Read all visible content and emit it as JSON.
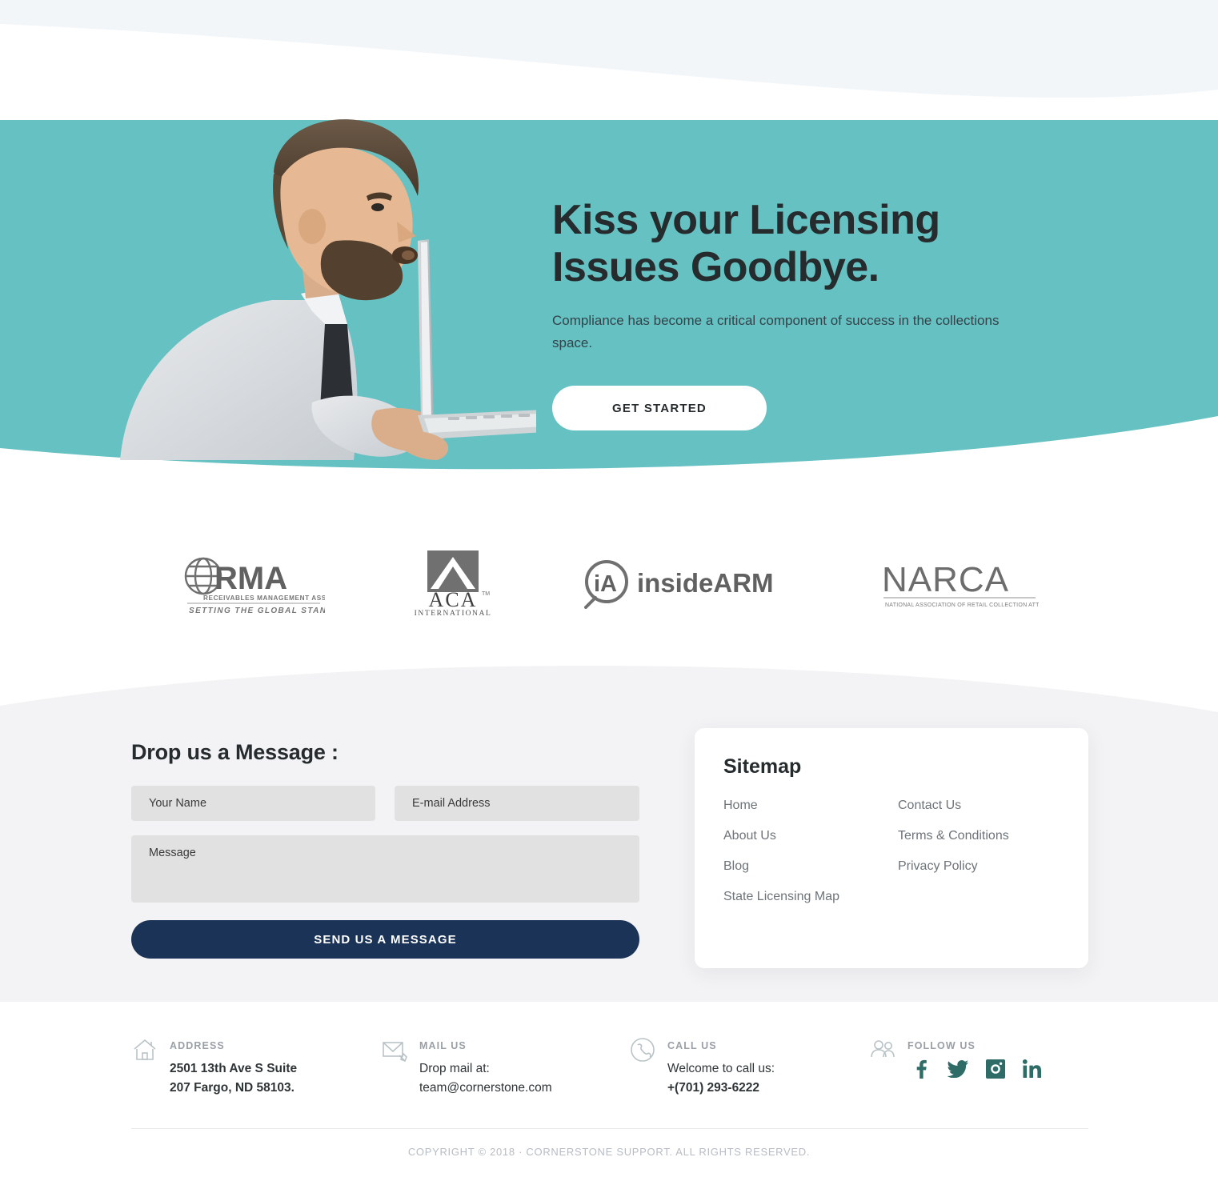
{
  "theme": {
    "teal": "#66c1c2",
    "navy": "#1b3356",
    "dark_text": "#262b2e",
    "grey_section": "#f3f3f5",
    "input_bg": "#e1e1e1",
    "social_teal": "#2f6c68",
    "muted": "#9aa0a6"
  },
  "hero": {
    "title_line1": "Kiss your Licensing",
    "title_line2": "Issues Goodbye.",
    "subtitle": "Compliance has become a critical component of success in the collections space.",
    "cta_label": "GET STARTED",
    "image_alt": "man-kissing-laptop-photo"
  },
  "logos": [
    {
      "name": "rma-logo",
      "title": "RMA",
      "sub1": "RECEIVABLES MANAGEMENT ASSOC.",
      "sub2": "SETTING THE GLOBAL STANDARD"
    },
    {
      "name": "aca-logo",
      "title": "ACA",
      "sub1": "INTERNATIONAL",
      "sub2": "TM"
    },
    {
      "name": "insidearm-logo",
      "title": "insideARM",
      "sub1": "iA",
      "sub2": ""
    },
    {
      "name": "narca-logo",
      "title": "NARCA",
      "sub1": "NATIONAL ASSOCIATION OF RETAIL COLLECTION ATTORNEYS",
      "sub2": ""
    }
  ],
  "contact_form": {
    "title": "Drop us a Message :",
    "name_placeholder": "Your Name",
    "name_value": "",
    "email_placeholder": "E-mail Address",
    "email_value": "",
    "message_placeholder": "Message",
    "message_value": "",
    "submit_label": "SEND US A MESSAGE"
  },
  "sitemap": {
    "title": "Sitemap",
    "links": [
      "Home",
      "Contact Us",
      "About Us",
      "Terms & Conditions",
      "Blog",
      "Privacy Policy",
      "State Licensing Map"
    ]
  },
  "footer": {
    "address": {
      "icon": "house-icon",
      "label": "ADDRESS",
      "line1": "2501 13th Ave S Suite",
      "line2": "207 Fargo, ND 58103."
    },
    "mail": {
      "icon": "envelope-pencil-icon",
      "label": "MAIL US",
      "line1": "Drop mail at:",
      "line2": "team@cornerstone.com"
    },
    "call": {
      "icon": "phone-circle-icon",
      "label": "CALL US",
      "line1": "Welcome to call us:",
      "line2": "+(701) 293-6222"
    },
    "follow": {
      "icon": "people-icon",
      "label": "FOLLOW US",
      "socials": [
        {
          "name": "facebook-icon",
          "glyph": "f"
        },
        {
          "name": "twitter-icon",
          "glyph": "t"
        },
        {
          "name": "instagram-icon",
          "glyph": "i"
        },
        {
          "name": "linkedin-icon",
          "glyph": "in"
        }
      ]
    },
    "copyright": "COPYRIGHT © 2018 · CORNERSTONE SUPPORT. ALL RIGHTS RESERVED."
  }
}
